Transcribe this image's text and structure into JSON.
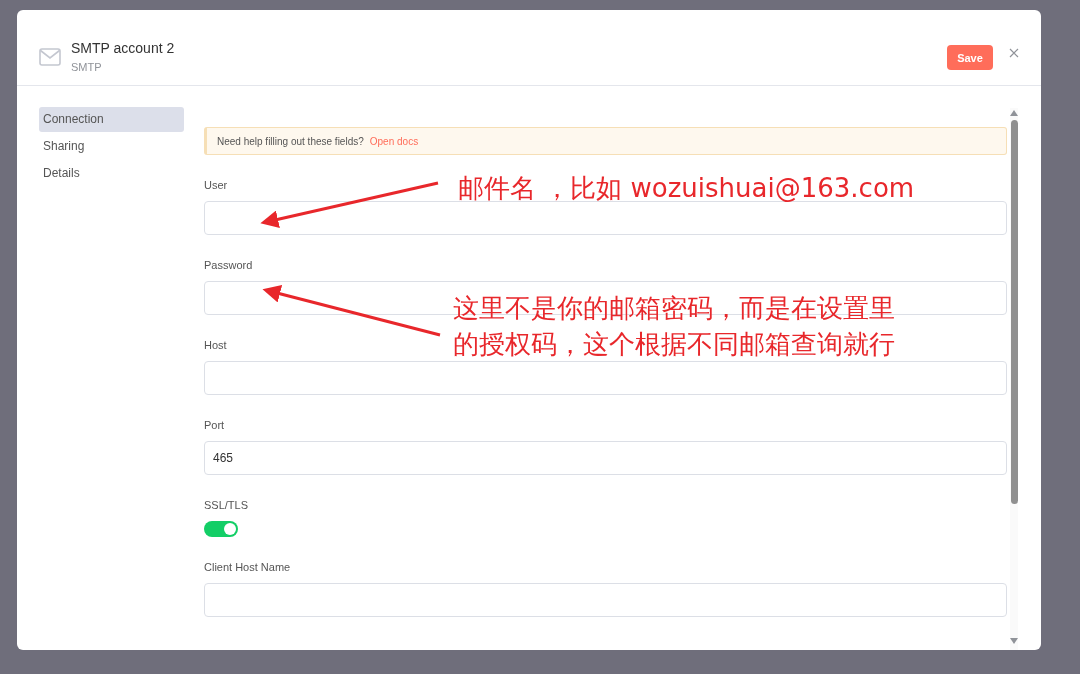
{
  "modal": {
    "title": "SMTP account 2",
    "subtitle": "SMTP",
    "save_button": "Save"
  },
  "sidebar": {
    "items": [
      {
        "label": "Connection",
        "selected": true
      },
      {
        "label": "Sharing",
        "selected": false
      },
      {
        "label": "Details",
        "selected": false
      }
    ]
  },
  "help_banner": {
    "text": "Need help filling out these fields?",
    "link": "Open docs"
  },
  "fields": [
    {
      "kind": "text",
      "label": "User"
    },
    {
      "kind": "text",
      "label": "Password"
    },
    {
      "kind": "text",
      "label": "Host"
    },
    {
      "kind": "text",
      "label": "Port",
      "value": "465"
    },
    {
      "kind": "toggle",
      "label": "SSL/TLS",
      "on": true
    },
    {
      "kind": "text",
      "label": "Client Host Name"
    }
  ],
  "annotations": [
    {
      "lines": [
        "邮件名 ，比如  wozuishuai@163.com"
      ]
    },
    {
      "lines": [
        "这里不是你的邮箱密码，而是在设置里",
        "的授权码，这个根据不同邮箱查询就行"
      ]
    }
  ]
}
